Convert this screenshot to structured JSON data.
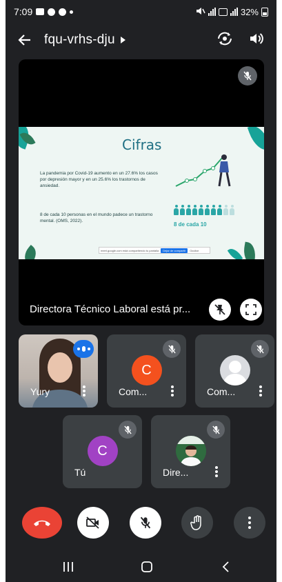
{
  "status_bar": {
    "time": "7:09",
    "battery": "32%"
  },
  "meeting": {
    "code": "fqu-vrhs-dju"
  },
  "presentation": {
    "presenting_label": "Directora Técnico Laboral está pr...",
    "slide": {
      "title": "Cifras",
      "text1": "La pandemia por Covid-19 aumento en un 27.6% los casos por depresión mayor y en un 25.6% los trastornos de ansiedad.",
      "text2": "8 de cada 10 personas en el mundo padece un trastorno mental. (OMS, 2022).",
      "stat": "8 de cada 10",
      "share_bar_text": "meet.google.com está compartiendo tu pantalla",
      "share_bar_stop": "Dejar de compartir",
      "share_bar_hide": "Ocultar"
    }
  },
  "participants": [
    {
      "name": "Yury",
      "type": "video",
      "speaking": true
    },
    {
      "name": "Com...",
      "type": "initial",
      "initial": "C",
      "color": "#f4511e",
      "muted": true
    },
    {
      "name": "Com...",
      "type": "photo",
      "muted": true
    },
    {
      "name": "Tú",
      "type": "initial",
      "initial": "C",
      "color": "#a142c4",
      "muted": true
    },
    {
      "name": "Dire...",
      "type": "photo",
      "muted": true
    }
  ],
  "colors": {
    "background": "#202124",
    "tile": "#3c4043",
    "end_call": "#ea4335",
    "accent": "#1a73e8"
  }
}
